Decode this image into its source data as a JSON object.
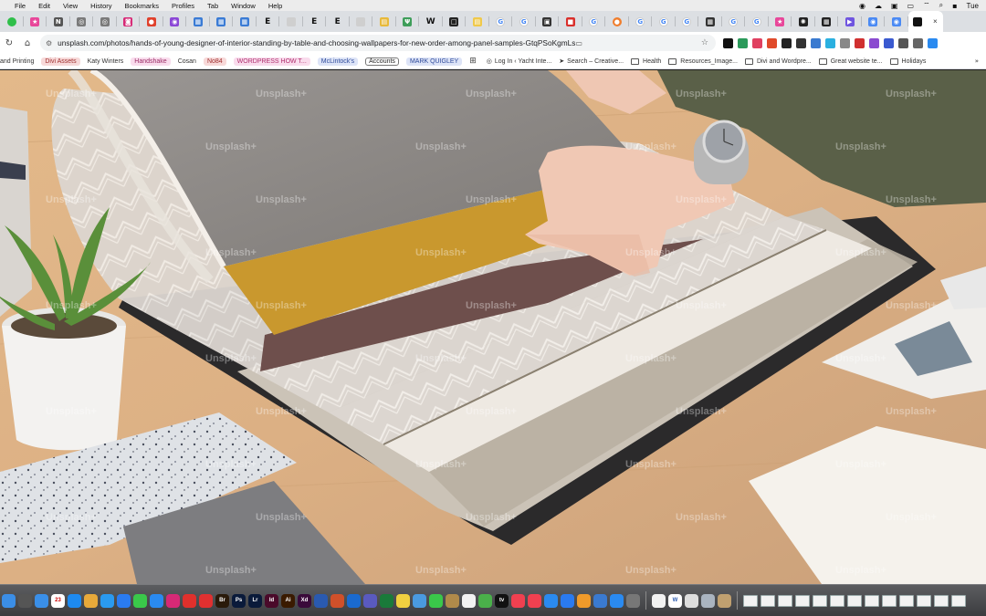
{
  "menu_bar": {
    "items": [
      "File",
      "Edit",
      "View",
      "History",
      "Bookmarks",
      "Profiles",
      "Tab",
      "Window",
      "Help"
    ],
    "clock": "Tue"
  },
  "tabs": [
    {
      "icon": "green-circle",
      "color": "#2fbf4a",
      "glyph": ""
    },
    {
      "icon": "pink-star",
      "color": "#e8479a",
      "glyph": "★"
    },
    {
      "icon": "n-logo",
      "color": "#555555",
      "glyph": "N"
    },
    {
      "icon": "globe",
      "color": "#7a7a7a",
      "glyph": "◎"
    },
    {
      "icon": "globe",
      "color": "#7a7a7a",
      "glyph": "◎"
    },
    {
      "icon": "instagram",
      "color": "#d62976",
      "glyph": "◙"
    },
    {
      "icon": "red-shield",
      "color": "#e0412c",
      "glyph": "●"
    },
    {
      "icon": "purple-app",
      "color": "#8b47d6",
      "glyph": "◉"
    },
    {
      "icon": "multicolor",
      "color": "#3a7bd5",
      "glyph": "▦"
    },
    {
      "icon": "multicolor",
      "color": "#3a7bd5",
      "glyph": "▦"
    },
    {
      "icon": "multicolor",
      "color": "#3a7bd5",
      "glyph": "▦"
    },
    {
      "icon": "e-logo",
      "color": "#111111",
      "glyph": "E"
    },
    {
      "icon": "blank",
      "color": "#cfcfcf",
      "glyph": ""
    },
    {
      "icon": "e-logo",
      "color": "#111111",
      "glyph": "E"
    },
    {
      "icon": "e-logo",
      "color": "#111111",
      "glyph": "E"
    },
    {
      "icon": "blank",
      "color": "#cfcfcf",
      "glyph": ""
    },
    {
      "icon": "yellow-doc",
      "color": "#e8b93a",
      "glyph": "▤"
    },
    {
      "icon": "plant",
      "color": "#3e9e5a",
      "glyph": "Ψ"
    },
    {
      "icon": "w-logo",
      "color": "#111111",
      "glyph": "W"
    },
    {
      "icon": "square",
      "color": "#222222",
      "glyph": "□"
    },
    {
      "icon": "yellow-doc",
      "color": "#f0c94a",
      "glyph": "▤"
    },
    {
      "icon": "google",
      "color": "#4285f4",
      "glyph": "G"
    },
    {
      "icon": "google",
      "color": "#4285f4",
      "glyph": "G"
    },
    {
      "icon": "briefcase",
      "color": "#333333",
      "glyph": "▣"
    },
    {
      "icon": "red-app",
      "color": "#d9302c",
      "glyph": "■"
    },
    {
      "icon": "google",
      "color": "#4285f4",
      "glyph": "G"
    },
    {
      "icon": "orange-circle",
      "color": "#f07d2c",
      "glyph": "●"
    },
    {
      "icon": "google",
      "color": "#4285f4",
      "glyph": "G"
    },
    {
      "icon": "google",
      "color": "#4285f4",
      "glyph": "G"
    },
    {
      "icon": "google",
      "color": "#4285f4",
      "glyph": "G"
    },
    {
      "icon": "dark-square",
      "color": "#333333",
      "glyph": "▦"
    },
    {
      "icon": "google",
      "color": "#4285f4",
      "glyph": "G"
    },
    {
      "icon": "google",
      "color": "#4285f4",
      "glyph": "G"
    },
    {
      "icon": "pink-star",
      "color": "#e8479a",
      "glyph": "★"
    },
    {
      "icon": "dark-app",
      "color": "#222222",
      "glyph": "✺"
    },
    {
      "icon": "dark-square",
      "color": "#222222",
      "glyph": "▦"
    },
    {
      "icon": "purple-play",
      "color": "#6f55e0",
      "glyph": "▶"
    },
    {
      "icon": "chrome",
      "color": "#4a8af4",
      "glyph": "◉"
    },
    {
      "icon": "chrome",
      "color": "#4a8af4",
      "glyph": "◉"
    }
  ],
  "active_tab": {
    "icon": "unsplash",
    "close": "×"
  },
  "address_bar": {
    "url": "unsplash.com/photos/hands-of-young-designer-of-interior-standing-by-table-and-choosing-wallpapers-for-new-order-among-panel-samples-GtqPSoKgmLs"
  },
  "bookmarks": [
    {
      "label": "and Printing",
      "style": "plain",
      "color": "#333333"
    },
    {
      "label": "Divi Assets",
      "style": "pill",
      "bg": "#f7d9d9",
      "color": "#a03030"
    },
    {
      "label": "Katy Winters",
      "style": "plain",
      "color": "#333333"
    },
    {
      "label": "Handshake",
      "style": "pill",
      "bg": "#f9dced",
      "color": "#9b2d66"
    },
    {
      "label": "Cosan",
      "style": "plain",
      "color": "#333333"
    },
    {
      "label": "No84",
      "style": "pill",
      "bg": "#f7d9d9",
      "color": "#a03030"
    },
    {
      "label": "WORDPRESS HOW T...",
      "style": "pill",
      "bg": "#f9dced",
      "color": "#b0306e"
    },
    {
      "label": "McLintock's",
      "style": "pill",
      "bg": "#dde4f7",
      "color": "#2e4a9b"
    },
    {
      "label": "Accounts",
      "style": "boxed",
      "color": "#222222"
    },
    {
      "label": "MARK QUIGLEY",
      "style": "pill",
      "bg": "#dde4f7",
      "color": "#2e4a9b"
    },
    {
      "label": "",
      "style": "grid",
      "color": "#444444"
    },
    {
      "label": "Log In ‹ Yacht Inte...",
      "style": "glyph",
      "glyph": "◎",
      "color": "#333333"
    },
    {
      "label": "Search – Creative...",
      "style": "glyph",
      "glyph": "➤",
      "color": "#333333"
    },
    {
      "label": "Health",
      "style": "folder",
      "color": "#333333"
    },
    {
      "label": "Resources_Image...",
      "style": "folder",
      "color": "#333333"
    },
    {
      "label": "Divi and Wordpre...",
      "style": "folder",
      "color": "#333333"
    },
    {
      "label": "Great website te...",
      "style": "folder",
      "color": "#333333"
    },
    {
      "label": "Holidays",
      "style": "folder",
      "color": "#333333"
    }
  ],
  "bookmarks_more": "»",
  "watermark": "Unsplash+",
  "dock": {
    "apps": [
      {
        "name": "finder",
        "color": "#3b8ee6",
        "text": ""
      },
      {
        "name": "calculator",
        "color": "#555555",
        "text": ""
      },
      {
        "name": "mail",
        "color": "#3a8fe8",
        "text": ""
      },
      {
        "name": "calendar",
        "color": "#ffffff",
        "text": "23"
      },
      {
        "name": "app-store",
        "color": "#1d8af0",
        "text": ""
      },
      {
        "name": "chrome",
        "color": "#e8a93a",
        "text": ""
      },
      {
        "name": "safari",
        "color": "#2a9af0",
        "text": ""
      },
      {
        "name": "messenger",
        "color": "#2a7bf0",
        "text": ""
      },
      {
        "name": "messages",
        "color": "#3ac84a",
        "text": ""
      },
      {
        "name": "app-store-2",
        "color": "#2a8af0",
        "text": ""
      },
      {
        "name": "instagram",
        "color": "#d62976",
        "text": ""
      },
      {
        "name": "acrobat",
        "color": "#e0302c",
        "text": ""
      },
      {
        "name": "red-app",
        "color": "#e03030",
        "text": ""
      },
      {
        "name": "bridge",
        "color": "#2a1a0a",
        "text": "Br"
      },
      {
        "name": "photoshop",
        "color": "#0a1a3a",
        "text": "Ps"
      },
      {
        "name": "lightroom",
        "color": "#0a1a3a",
        "text": "Lr"
      },
      {
        "name": "indesign",
        "color": "#4a0a2a",
        "text": "Id"
      },
      {
        "name": "illustrator",
        "color": "#3a1a00",
        "text": "Ai"
      },
      {
        "name": "xd",
        "color": "#3a0a3a",
        "text": "Xd"
      },
      {
        "name": "word",
        "color": "#2a5ab0",
        "text": ""
      },
      {
        "name": "powerpoint",
        "color": "#d0502a",
        "text": ""
      },
      {
        "name": "outlook",
        "color": "#1a6ad0",
        "text": ""
      },
      {
        "name": "teams",
        "color": "#5a5ac0",
        "text": ""
      },
      {
        "name": "excel",
        "color": "#1a7a3a",
        "text": ""
      },
      {
        "name": "notes",
        "color": "#f0d040",
        "text": ""
      },
      {
        "name": "preview",
        "color": "#4a9ae0",
        "text": ""
      },
      {
        "name": "facetime",
        "color": "#3ac84a",
        "text": ""
      },
      {
        "name": "archive",
        "color": "#b08a4a",
        "text": ""
      },
      {
        "name": "reminders",
        "color": "#f2f2f2",
        "text": ""
      },
      {
        "name": "maps",
        "color": "#4ab04a",
        "text": ""
      },
      {
        "name": "tv",
        "color": "#111111",
        "text": "tv"
      },
      {
        "name": "music",
        "color": "#f04050",
        "text": ""
      },
      {
        "name": "news",
        "color": "#f04050",
        "text": ""
      },
      {
        "name": "ios-app-store",
        "color": "#2a8af0",
        "text": ""
      },
      {
        "name": "keynote",
        "color": "#2a7af0",
        "text": ""
      },
      {
        "name": "pages",
        "color": "#f09a2a",
        "text": ""
      },
      {
        "name": "network",
        "color": "#3a7ad0",
        "text": ""
      },
      {
        "name": "screen-share",
        "color": "#2a8af0",
        "text": ""
      },
      {
        "name": "utility",
        "color": "#777777",
        "text": ""
      }
    ],
    "right_apps": [
      {
        "name": "textedit",
        "color": "#f2f2f2",
        "text": ""
      },
      {
        "name": "word-doc",
        "color": "#ffffff",
        "text": "W"
      },
      {
        "name": "script",
        "color": "#dddddd",
        "text": ""
      },
      {
        "name": "monitor",
        "color": "#aab4c0",
        "text": ""
      },
      {
        "name": "installer",
        "color": "#c0a070",
        "text": ""
      }
    ],
    "window_thumbs": 13
  }
}
